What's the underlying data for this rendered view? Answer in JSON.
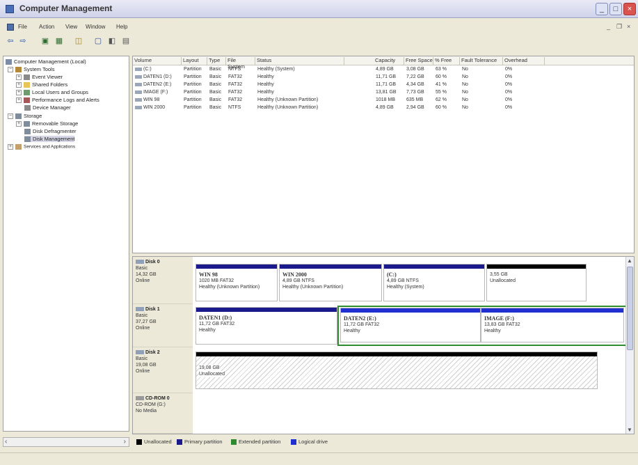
{
  "window": {
    "title": "Computer Management"
  },
  "menu": [
    "File",
    "Action",
    "View",
    "Window",
    "Help"
  ],
  "toolbar": {
    "icons": [
      "back-icon",
      "forward-icon",
      "up-icon",
      "show-hide-tree-icon",
      "properties-icon",
      "help-icon",
      "mmc-icon",
      "export-icon"
    ]
  },
  "tree": {
    "root": "Computer Management (Local)",
    "system_tools": "System Tools",
    "event_viewer": "Event Viewer",
    "shared_folders": "Shared Folders",
    "local_users": "Local Users and Groups",
    "perf_logs": "Performance Logs and Alerts",
    "device_manager": "Device Manager",
    "storage": "Storage",
    "removable": "Removable Storage",
    "defrag": "Disk Defragmenter",
    "disk_mgmt": "Disk Management",
    "services": "Services and Applications"
  },
  "volumes": {
    "columns": [
      "Volume",
      "Layout",
      "Type",
      "File System",
      "Status",
      "Capacity",
      "Free Space",
      "% Free",
      "Fault Tolerance",
      "Overhead"
    ],
    "rows": [
      [
        "(C:)",
        "Partition",
        "Basic",
        "NTFS",
        "Healthy (System)",
        "4,89 GB",
        "3,08 GB",
        "63 %",
        "No",
        "0%"
      ],
      [
        "DATEN1 (D:)",
        "Partition",
        "Basic",
        "FAT32",
        "Healthy",
        "11,71 GB",
        "7,22 GB",
        "60 %",
        "No",
        "0%"
      ],
      [
        "DATEN2 (E:)",
        "Partition",
        "Basic",
        "FAT32",
        "Healthy",
        "11,71 GB",
        "4,34 GB",
        "41 %",
        "No",
        "0%"
      ],
      [
        "IMAGE (F:)",
        "Partition",
        "Basic",
        "FAT32",
        "Healthy",
        "13,81 GB",
        "7,73 GB",
        "55 %",
        "No",
        "0%"
      ],
      [
        "WIN 98",
        "Partition",
        "Basic",
        "FAT32",
        "Healthy (Unknown Partition)",
        "1018 MB",
        "635 MB",
        "62 %",
        "No",
        "0%"
      ],
      [
        "WIN 2000",
        "Partition",
        "Basic",
        "NTFS",
        "Healthy (Unknown Partition)",
        "4,89 GB",
        "2,94 GB",
        "60 %",
        "No",
        "0%"
      ]
    ]
  },
  "disks": [
    {
      "name": "Disk 0",
      "type": "Basic",
      "size": "14,32 GB",
      "state": "Online",
      "partitions": [
        {
          "title": "WIN 98",
          "detail": "1020 MB FAT32",
          "status": "Healthy (Unknown Partition)"
        },
        {
          "title": "WIN 2000",
          "detail": "4,89 GB NTFS",
          "status": "Healthy (Unknown Partition)"
        },
        {
          "title": "(C:)",
          "detail": "4,89 GB NTFS",
          "status": "Healthy (System)"
        },
        {
          "title": "",
          "detail": "3,55 GB",
          "status": "Unallocated"
        }
      ]
    },
    {
      "name": "Disk 1",
      "type": "Basic",
      "size": "37,27 GB",
      "state": "Online",
      "partitions": [
        {
          "title": "DATEN1 (D:)",
          "detail": "11,72 GB FAT32",
          "status": "Healthy"
        },
        {
          "title": "DATEN2 (E:)",
          "detail": "11,72 GB FAT32",
          "status": "Healthy"
        },
        {
          "title": "IMAGE (F:)",
          "detail": "13,83 GB FAT32",
          "status": "Healthy"
        }
      ]
    },
    {
      "name": "Disk 2",
      "type": "Basic",
      "size": "19,08 GB",
      "state": "Online",
      "partitions": [
        {
          "title": "",
          "detail": "19,08 GB",
          "status": "Unallocated"
        }
      ]
    },
    {
      "name": "CD-ROM 0",
      "type": "CD-ROM (G:)",
      "size": "",
      "state": "No Media",
      "partitions": []
    }
  ],
  "legend": [
    "Unallocated",
    "Primary partition",
    "Extended partition",
    "Logical drive"
  ],
  "colors": {
    "unallocated": "#000000",
    "primary": "#1a1a8c",
    "extended": "#2e8b2e",
    "logical": "#2030d0"
  }
}
